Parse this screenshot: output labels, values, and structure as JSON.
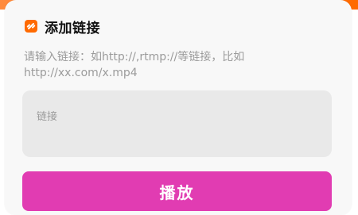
{
  "dialog": {
    "title": "添加链接",
    "title_icon": "link-icon",
    "hint_text": "请输入链接：如http://,rtmp://等链接，比如http://xx.com/x.mp4",
    "input": {
      "placeholder": "链接",
      "value": ""
    },
    "play_button_label": "播放"
  },
  "colors": {
    "accent": "#e13cb2",
    "icon_orange": "#ff6a00",
    "title_text": "#111111",
    "hint_text": "#9b9b9b",
    "input_bg": "#e9e9e9"
  }
}
